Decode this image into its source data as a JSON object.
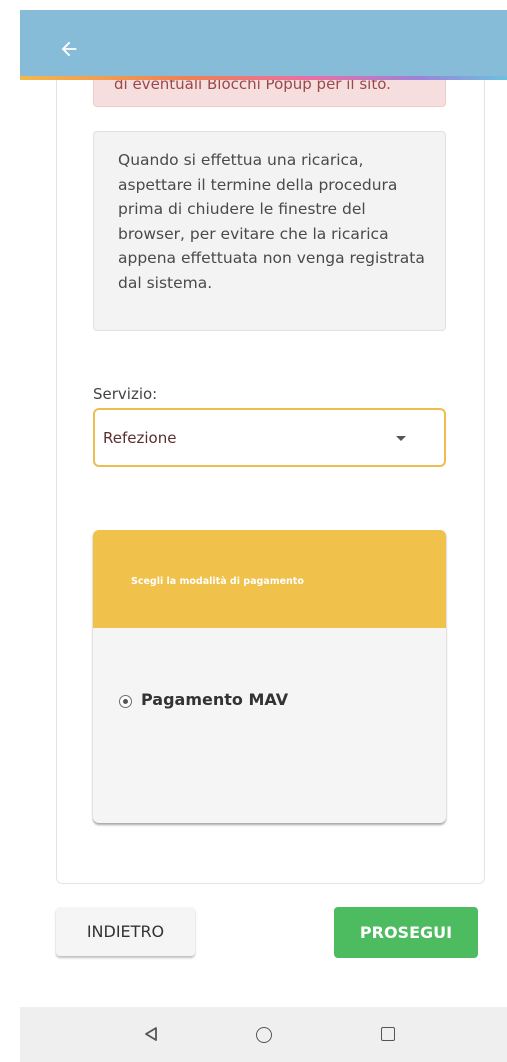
{
  "header": {
    "back_icon": "arrow-left-icon",
    "bg_color": "#86bcd8"
  },
  "alert": {
    "text": "di eventuali Blocchi Popup per il sito."
  },
  "info": {
    "text": "Quando si effettua una ricarica, aspettare il termine della procedura prima di chiudere le finestre del browser, per evitare che la ricarica appena effettuata non venga registrata dal sistema."
  },
  "service": {
    "label": "Servizio:",
    "selected": "Refezione",
    "caret_icon": "caret-down-icon"
  },
  "payment": {
    "title": "Scegli la modalità di pagamento",
    "option": "Pagamento MAV",
    "option_selected": true,
    "header_color": "#f0c14b"
  },
  "buttons": {
    "back_label": "INDIETRO",
    "next_label": "PROSEGUI",
    "next_color": "#4dbb5f"
  },
  "navbar": {
    "icons": [
      "triangle-back-icon",
      "circle-home-icon",
      "square-recent-icon"
    ]
  }
}
